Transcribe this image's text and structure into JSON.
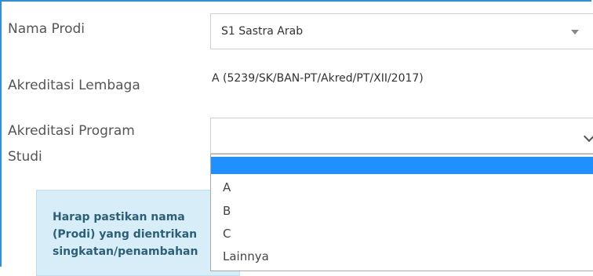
{
  "form": {
    "nama_prodi_label": "Nama Prodi",
    "nama_prodi_value": "S1 Sastra Arab",
    "akreditasi_lembaga_label": "Akreditasi Lembaga",
    "akreditasi_lembaga_value": "A (5239/SK/BAN-PT/Akred/PT/XII/2017)",
    "akreditasi_prodi_label_line1": "Akreditasi Program",
    "akreditasi_prodi_label_line2": "Studi",
    "akreditasi_prodi_value": ""
  },
  "dropdown": {
    "options": [
      "",
      "A",
      "B",
      "C",
      "Lainnya"
    ],
    "selected_index": 0,
    "highlight_color": "#1e90ff"
  },
  "info": {
    "line1": "Harap pastikan nama",
    "line2": "(Prodi) yang dientrikan",
    "line3": "singkatan/penambahan"
  },
  "colors": {
    "frame_border": "#2f8fd8",
    "info_bg": "#d7eef8",
    "info_text": "#2c5f78"
  },
  "icons": {
    "nama_prodi_dropdown": "caret-down-icon",
    "akreditasi_prodi_dropdown": "chevron-down-icon"
  }
}
